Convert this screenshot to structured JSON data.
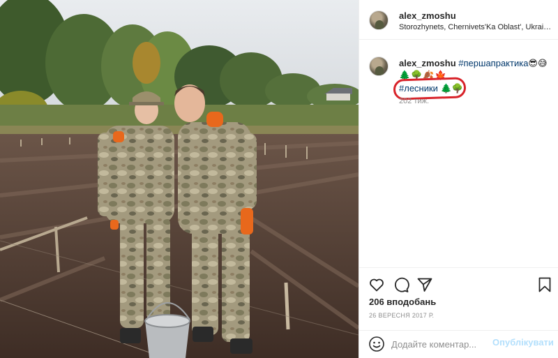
{
  "post": {
    "username": "alex_zmoshu",
    "location": "Storozhynets, Chernivets'Ka Oblast', Ukrai…",
    "photo_alt": "Two men in camouflage uniforms standing in a plowed field"
  },
  "caption": {
    "username": "alex_zmoshu",
    "hashtag1": "#першапрактика",
    "hashtag1_emojis": "😎😅",
    "emoji_line": "🌲🌳🍂🍁",
    "hashtag2": "#лесники",
    "hashtag2_emojis": "🌲🌳",
    "time_ago": "202 тиж."
  },
  "actions": {
    "like_icon": "heart-icon",
    "comment_icon": "speech-bubble-icon",
    "share_icon": "paper-plane-icon",
    "save_icon": "bookmark-icon",
    "likes_text": "206 вподобань",
    "date_text": "26 ВЕРЕСНЯ 2017 Р."
  },
  "comment": {
    "emoji_icon": "smiley-icon",
    "placeholder": "Додайте коментар...",
    "post_label": "Опублікувати"
  },
  "colors": {
    "hashtag": "#00376b",
    "highlight_circle": "#d8232a",
    "post_button_disabled": "#b2dffc",
    "muted_text": "#8e8e8e"
  }
}
